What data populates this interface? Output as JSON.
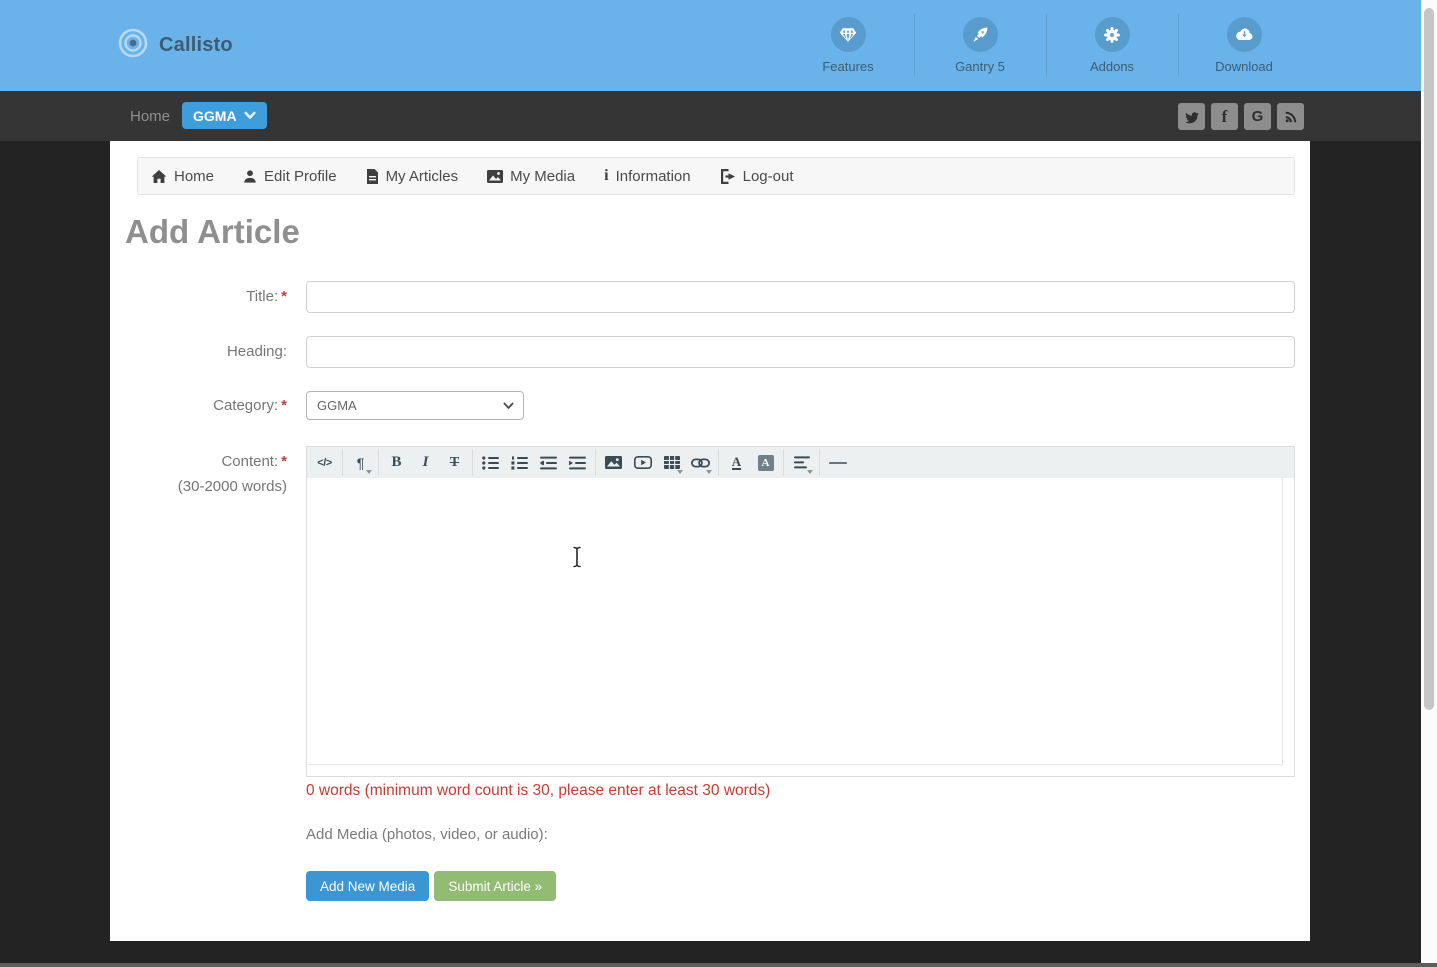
{
  "header": {
    "brand": "Callisto",
    "nav_items": [
      {
        "label": "Features",
        "icon": "diamond"
      },
      {
        "label": "Gantry 5",
        "icon": "rocket"
      },
      {
        "label": "Addons",
        "icon": "gear"
      },
      {
        "label": "Download",
        "icon": "cloud-download"
      }
    ]
  },
  "navbar": {
    "home_label": "Home",
    "dropdown_label": "GGMA",
    "social_icons": [
      "twitter",
      "facebook",
      "google",
      "rss"
    ]
  },
  "user_menu": {
    "items": [
      {
        "label": "Home",
        "icon": "home"
      },
      {
        "label": "Edit Profile",
        "icon": "user"
      },
      {
        "label": "My Articles",
        "icon": "file-text"
      },
      {
        "label": "My Media",
        "icon": "image"
      },
      {
        "label": "Information",
        "icon": "info"
      },
      {
        "label": "Log-out",
        "icon": "sign-out"
      }
    ]
  },
  "page": {
    "title": "Add Article",
    "form": {
      "title_label": "Title:",
      "heading_label": "Heading:",
      "category_label": "Category:",
      "category_value": "GGMA",
      "content_label": "Content:",
      "content_hint": "(30-2000 words)",
      "required_marker": "*"
    },
    "editor": {
      "glyphs": {
        "view_html": "</>",
        "paragraph": "¶",
        "bold": "B",
        "italic": "I",
        "strikethrough": "T",
        "fore_color": "A",
        "back_color": "A"
      },
      "toolbar_icons": [
        "view-html",
        "paragraph",
        "bold",
        "italic",
        "strikethrough",
        "unordered-list",
        "ordered-list",
        "outdent",
        "indent",
        "insert-image",
        "insert-video",
        "insert-table",
        "create-link",
        "text-color",
        "background-color",
        "align-left",
        "horizontal-rule"
      ]
    },
    "word_count_warning": "0 words (minimum word count is 30, please enter at least 30 words)",
    "add_media_label": "Add Media (photos, video, or audio):",
    "buttons": {
      "add_media": "Add New Media",
      "submit": "Submit Article »"
    }
  },
  "colors": {
    "header_bg": "#6ab3ea",
    "navbar_bg": "#353535",
    "page_bg": "#232323",
    "accent_blue": "#3f9ddb",
    "button_blue": "#3c96d4",
    "button_green": "#92bb73",
    "warning_red": "#ca3a32"
  }
}
